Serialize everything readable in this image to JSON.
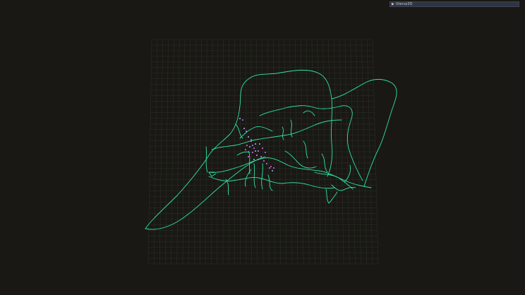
{
  "gui": {
    "arrow": "▶",
    "title": "Uterus3D"
  },
  "colors": {
    "background": "#191814",
    "grid": "#2b3326",
    "path": "#2fe3a6",
    "points": "#e06cff",
    "points_alt": "#a8b0ff"
  },
  "icons": {
    "collapse": "triangle-right-icon"
  }
}
